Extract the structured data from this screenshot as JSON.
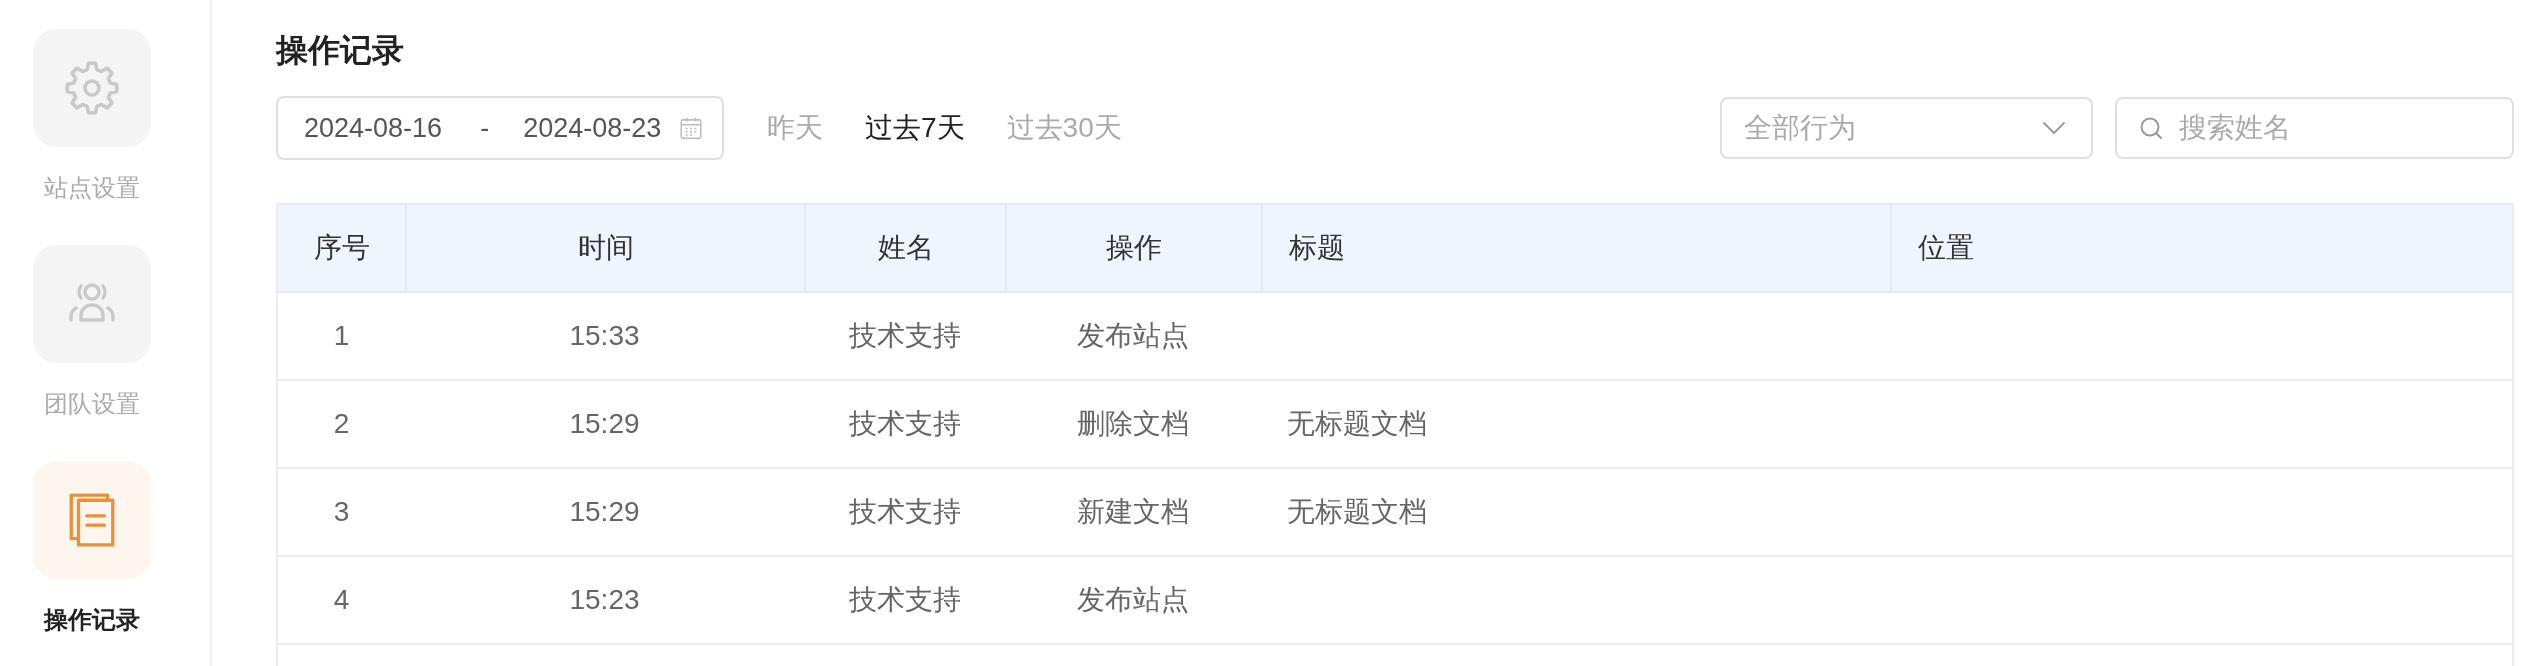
{
  "sidebar": {
    "items": [
      {
        "label": "站点设置",
        "selected": false
      },
      {
        "label": "团队设置",
        "selected": false
      },
      {
        "label": "操作记录",
        "selected": true
      }
    ]
  },
  "page": {
    "title": "操作记录"
  },
  "filters": {
    "date_range": {
      "start": "2024-08-16",
      "separator": "-",
      "end": "2024-08-23"
    },
    "quick_ranges": [
      {
        "label": "昨天",
        "selected": false
      },
      {
        "label": "过去7天",
        "selected": true
      },
      {
        "label": "过去30天",
        "selected": false
      }
    ],
    "action_select": {
      "placeholder": "全部行为"
    },
    "search": {
      "placeholder": "搜索姓名"
    }
  },
  "table": {
    "columns": [
      "序号",
      "时间",
      "姓名",
      "操作",
      "标题",
      "位置"
    ],
    "rows": [
      {
        "index": "1",
        "time": "15:33",
        "name": "技术支持",
        "action": "发布站点"
      },
      {
        "index": "2",
        "time": "15:29",
        "name": "技术支持",
        "action": "删除文档",
        "title": "无标题文档"
      },
      {
        "index": "3",
        "time": "15:29",
        "name": "技术支持",
        "action": "新建文档",
        "title": "无标题文档"
      },
      {
        "index": "4",
        "time": "15:23",
        "name": "技术支持",
        "action": "发布站点"
      }
    ]
  }
}
